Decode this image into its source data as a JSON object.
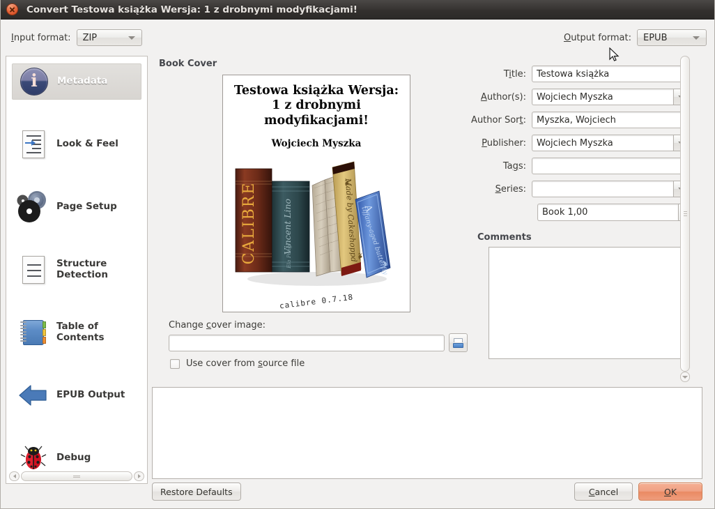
{
  "window": {
    "title": "Convert Testowa książka Wersja: 1 z drobnymi modyfikacjami!",
    "close_icon": "close-icon"
  },
  "formats": {
    "input_label": "Input format:",
    "input_label_prefix": "I",
    "input_label_rest": "nput format:",
    "input_value": "ZIP",
    "output_label_prefix": "O",
    "output_label_rest": "utput format:",
    "output_value": "EPUB"
  },
  "sidebar": {
    "items": [
      {
        "label": "Metadata",
        "icon": "info-icon",
        "selected": true
      },
      {
        "label": "Look & Feel",
        "icon": "document-arrow-icon",
        "selected": false
      },
      {
        "label": "Page Setup",
        "icon": "gears-icon",
        "selected": false
      },
      {
        "label": "Structure Detection",
        "label_line1": "Structure",
        "label_line2": "Detection",
        "icon": "document-lines-icon",
        "selected": false
      },
      {
        "label": "Table of Contents",
        "label_line1": "Table of",
        "label_line2": "Contents",
        "icon": "notebook-icon",
        "selected": false
      },
      {
        "label": "EPUB Output",
        "icon": "left-arrow-icon",
        "selected": false
      },
      {
        "label": "Debug",
        "icon": "ladybug-icon",
        "selected": false
      }
    ]
  },
  "main": {
    "book_cover_title": "Book Cover",
    "cover": {
      "title": "Testowa książka Wersja: 1 z drobnymi modyfikacjami!",
      "author": "Wojciech Myszka",
      "version": "calibre 0.7.18",
      "spines": [
        "CALIBRE",
        "Vincent Lino",
        "Made by Cakeshoppd",
        "tiffany-gold butterfly"
      ]
    },
    "change_cover_label_prefix": "Change ",
    "change_cover_label_key": "c",
    "change_cover_label_rest": "over image:",
    "cover_path_value": "",
    "cover_path_placeholder": "",
    "browse_icon": "folder-open-icon",
    "use_source_cover": {
      "checked": false,
      "label_prefix": "Use cover from ",
      "label_key": "s",
      "label_rest": "ource file"
    }
  },
  "form": {
    "fields": [
      {
        "label_prefix": "T",
        "label_key": "i",
        "label_rest": "tle:",
        "value": "Testowa książka",
        "type": "text"
      },
      {
        "label_prefix": "",
        "label_key": "A",
        "label_rest": "uthor(s):",
        "value": "Wojciech Myszka",
        "type": "combo"
      },
      {
        "label_prefix": "Author Sor",
        "label_key": "t",
        "label_rest": ":",
        "value": "Myszka, Wojciech",
        "type": "text"
      },
      {
        "label_prefix": "",
        "label_key": "P",
        "label_rest": "ublisher:",
        "value": "Wojciech Myszka",
        "type": "combo"
      },
      {
        "label_prefix": "Ta",
        "label_key": "g",
        "label_rest": "s:",
        "value": "",
        "type": "text"
      },
      {
        "label_prefix": "",
        "label_key": "S",
        "label_rest": "eries:",
        "value": "",
        "type": "combo"
      }
    ],
    "series_index": "Book 1,00",
    "comments_title": "Comments",
    "comments_value": ""
  },
  "buttons": {
    "restore_defaults": "Restore Defaults",
    "cancel_prefix": "",
    "cancel_key": "C",
    "cancel_rest": "ancel",
    "ok_prefix": "",
    "ok_key": "O",
    "ok_rest": "K"
  },
  "colors": {
    "accent_orange": "#ea8a63",
    "titlebar": "#33302e",
    "window_bg": "#f2f1f0",
    "selected_item": "#ddd9d5"
  }
}
